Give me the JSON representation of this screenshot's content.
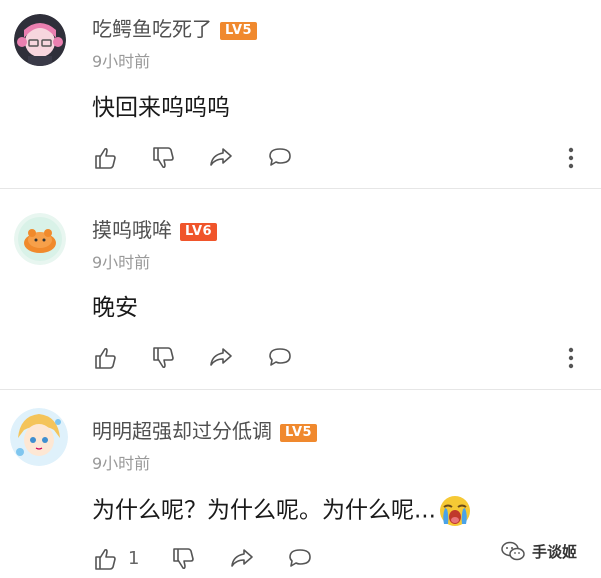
{
  "comments": [
    {
      "username": "吃鳄鱼吃死了",
      "level": "LV5",
      "time": "9小时前",
      "content": "快回来呜呜呜",
      "likes": ""
    },
    {
      "username": "摸呜哦哞",
      "level": "LV6",
      "time": "9小时前",
      "content": "晚安",
      "likes": ""
    },
    {
      "username": "明明超强却过分低调",
      "level": "LV5",
      "time": "9小时前",
      "content": "为什么呢？为什么呢。为什么呢...",
      "likes": "1"
    }
  ],
  "watermark": {
    "text": "手谈姬"
  },
  "colors": {
    "lv5": "#f0892e",
    "lv6": "#f0552b",
    "icon": "#555555"
  }
}
